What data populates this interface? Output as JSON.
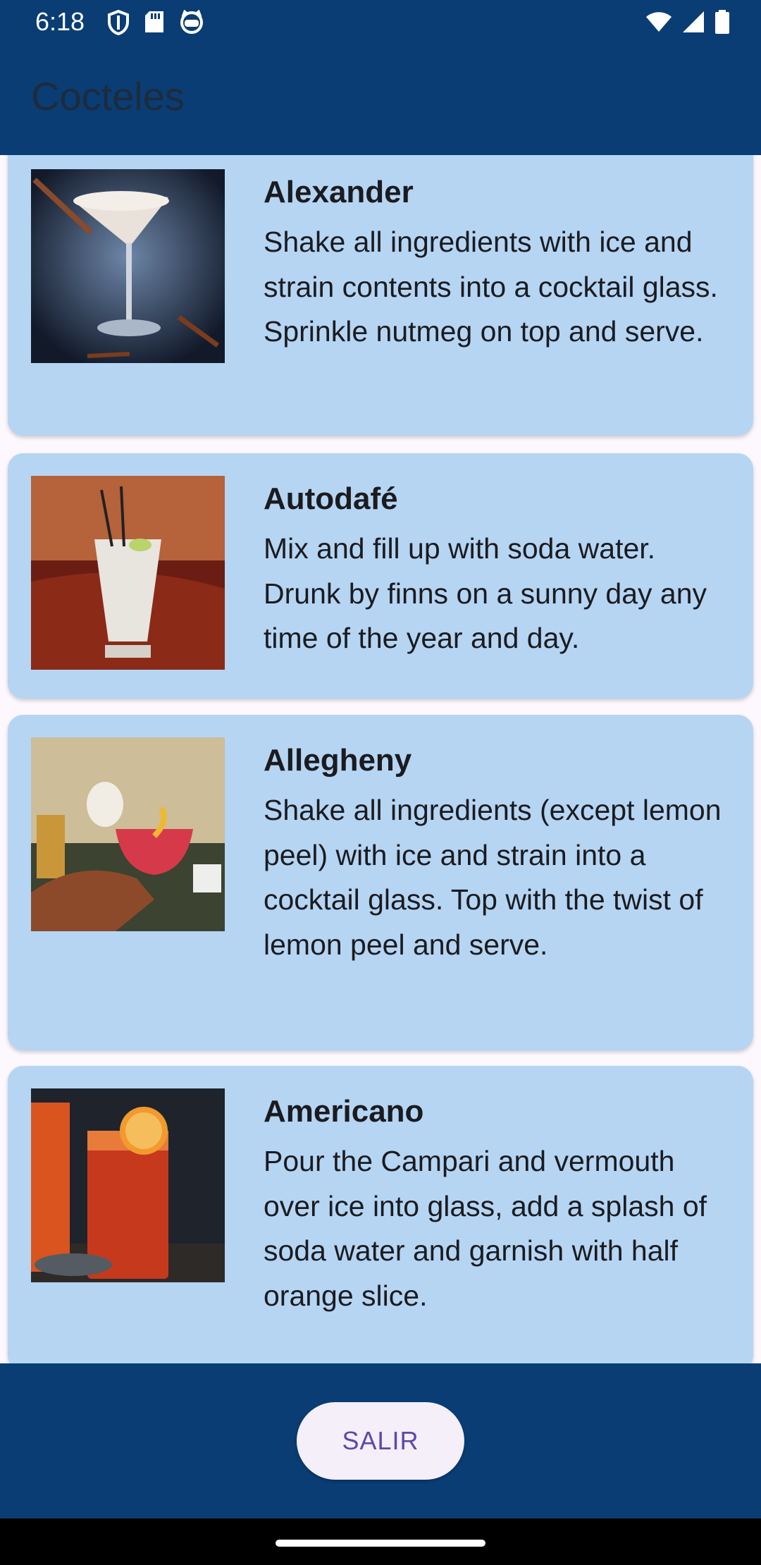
{
  "status": {
    "time": "6:18",
    "left_icons": [
      "shield-icon",
      "sd-card-icon",
      "cat-face-icon"
    ],
    "right_icons": [
      "wifi-icon",
      "signal-icon",
      "battery-icon"
    ]
  },
  "app_bar": {
    "title": "Cocteles"
  },
  "cocktails": [
    {
      "name": "Alexander",
      "description": "Shake all ingredients with ice and strain contents into a cocktail glass. Sprinkle nutmeg on top and serve.",
      "image": "cocktail-photo-alexander"
    },
    {
      "name": "Autodafé",
      "description": "Mix and fill up with soda water. Drunk by finns on a sunny day any time of the year and day.",
      "image": "cocktail-photo-autodafe"
    },
    {
      "name": "Allegheny",
      "description": "Shake all ingredients (except lemon peel) with ice and strain into a cocktail glass. Top with the twist of lemon peel and serve.",
      "image": "cocktail-photo-allegheny"
    },
    {
      "name": "Americano",
      "description": "Pour the Campari and vermouth over ice into glass, add a splash of soda water and garnish with half orange slice.",
      "image": "cocktail-photo-americano"
    }
  ],
  "bottom": {
    "exit_label": "SALIR"
  },
  "colors": {
    "primary_dark": "#0a3d74",
    "card_bg": "#b5d5f3",
    "button_bg": "#f4eff8",
    "button_text": "#5b49a8"
  }
}
